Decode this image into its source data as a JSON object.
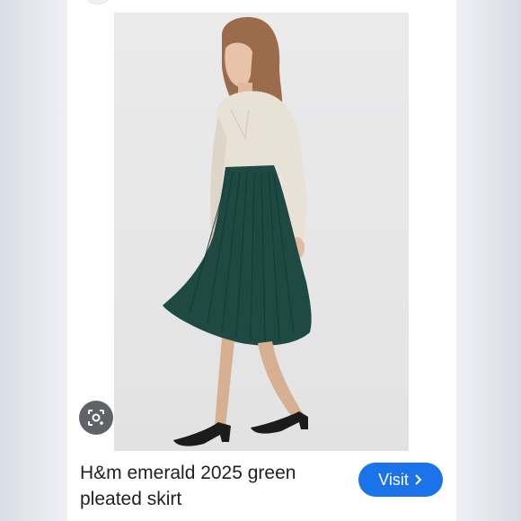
{
  "result": {
    "title": "H&m emerald 2025 green pleated skirt",
    "visit_label": "Visit",
    "colors": {
      "visit_button": "#1a73e8",
      "skirt": "#1f4a44",
      "blouse": "#e8e1d6",
      "shoes": "#1b1b1b"
    },
    "icons": {
      "lens": "google-lens-icon",
      "visit_arrow": "chevron-right-icon"
    },
    "image_subject": "model wearing emerald green pleated midi skirt"
  }
}
